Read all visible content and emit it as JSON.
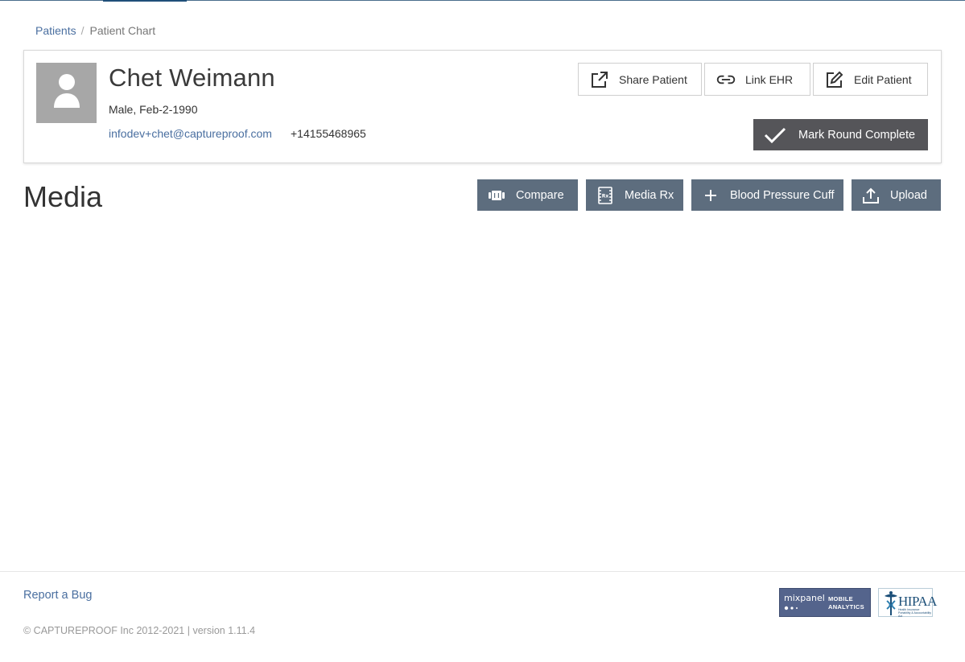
{
  "breadcrumb": {
    "items": [
      "Patients",
      "Patient Chart"
    ],
    "separator": "/"
  },
  "patient": {
    "name": "Chet Weimann",
    "demographics": "Male, Feb-2-1990",
    "email": "infodev+chet@captureproof.com",
    "phone": "+14155468965",
    "avatar_icon": "person-silhouette-icon"
  },
  "patient_actions": {
    "share_label": "Share Patient",
    "link_label": "Link EHR",
    "edit_label": "Edit Patient",
    "round_label": "Mark Round Complete"
  },
  "media": {
    "title": "Media",
    "compare_label": "Compare",
    "mediarx_label": "Media Rx",
    "bpc_label": "Blood Pressure Cuff",
    "upload_label": "Upload"
  },
  "footer": {
    "report_label": "Report a Bug",
    "copyright": "© CAPTUREPROOF Inc 2012-2021 | version 1.11.4",
    "mixpanel_name": "mixpanel",
    "mixpanel_tag1": "MOBILE",
    "mixpanel_tag2": "ANALYTICS",
    "hipaa_text": "HIPAA",
    "hipaa_sub": "Health Insurance Portability & Accountability Act"
  },
  "colors": {
    "link": "#4a6fa0",
    "slate_button": "#5d6d7e",
    "dark_button": "#555559",
    "avatar_bg": "#a7a7a7"
  }
}
